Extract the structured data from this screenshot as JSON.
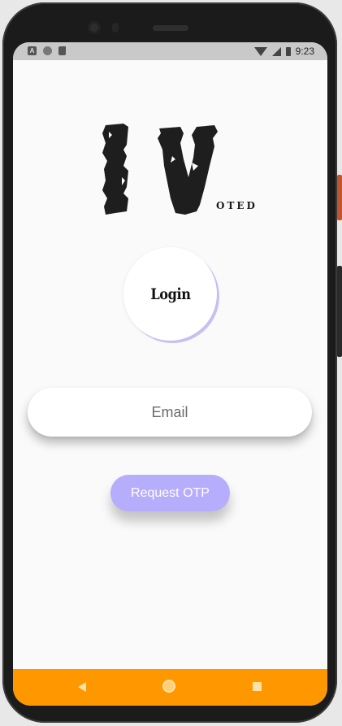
{
  "status_bar": {
    "time": "9:23",
    "left_icons": [
      "a-icon",
      "circle-icon",
      "sd-card-icon"
    ],
    "right_icons": [
      "wifi-icon",
      "signal-icon",
      "battery-icon"
    ]
  },
  "logo": {
    "letters": "I V",
    "subtext": "OTED"
  },
  "login_badge": {
    "label": "Login"
  },
  "form": {
    "email_placeholder": "Email",
    "email_value": "",
    "request_otp_label": "Request OTP"
  },
  "nav_bar": {
    "buttons": [
      "back-icon",
      "home-icon",
      "recents-icon"
    ]
  },
  "colors": {
    "accent": "#b6adfc",
    "nav_bar": "#ff9800",
    "background": "#fafafa"
  }
}
